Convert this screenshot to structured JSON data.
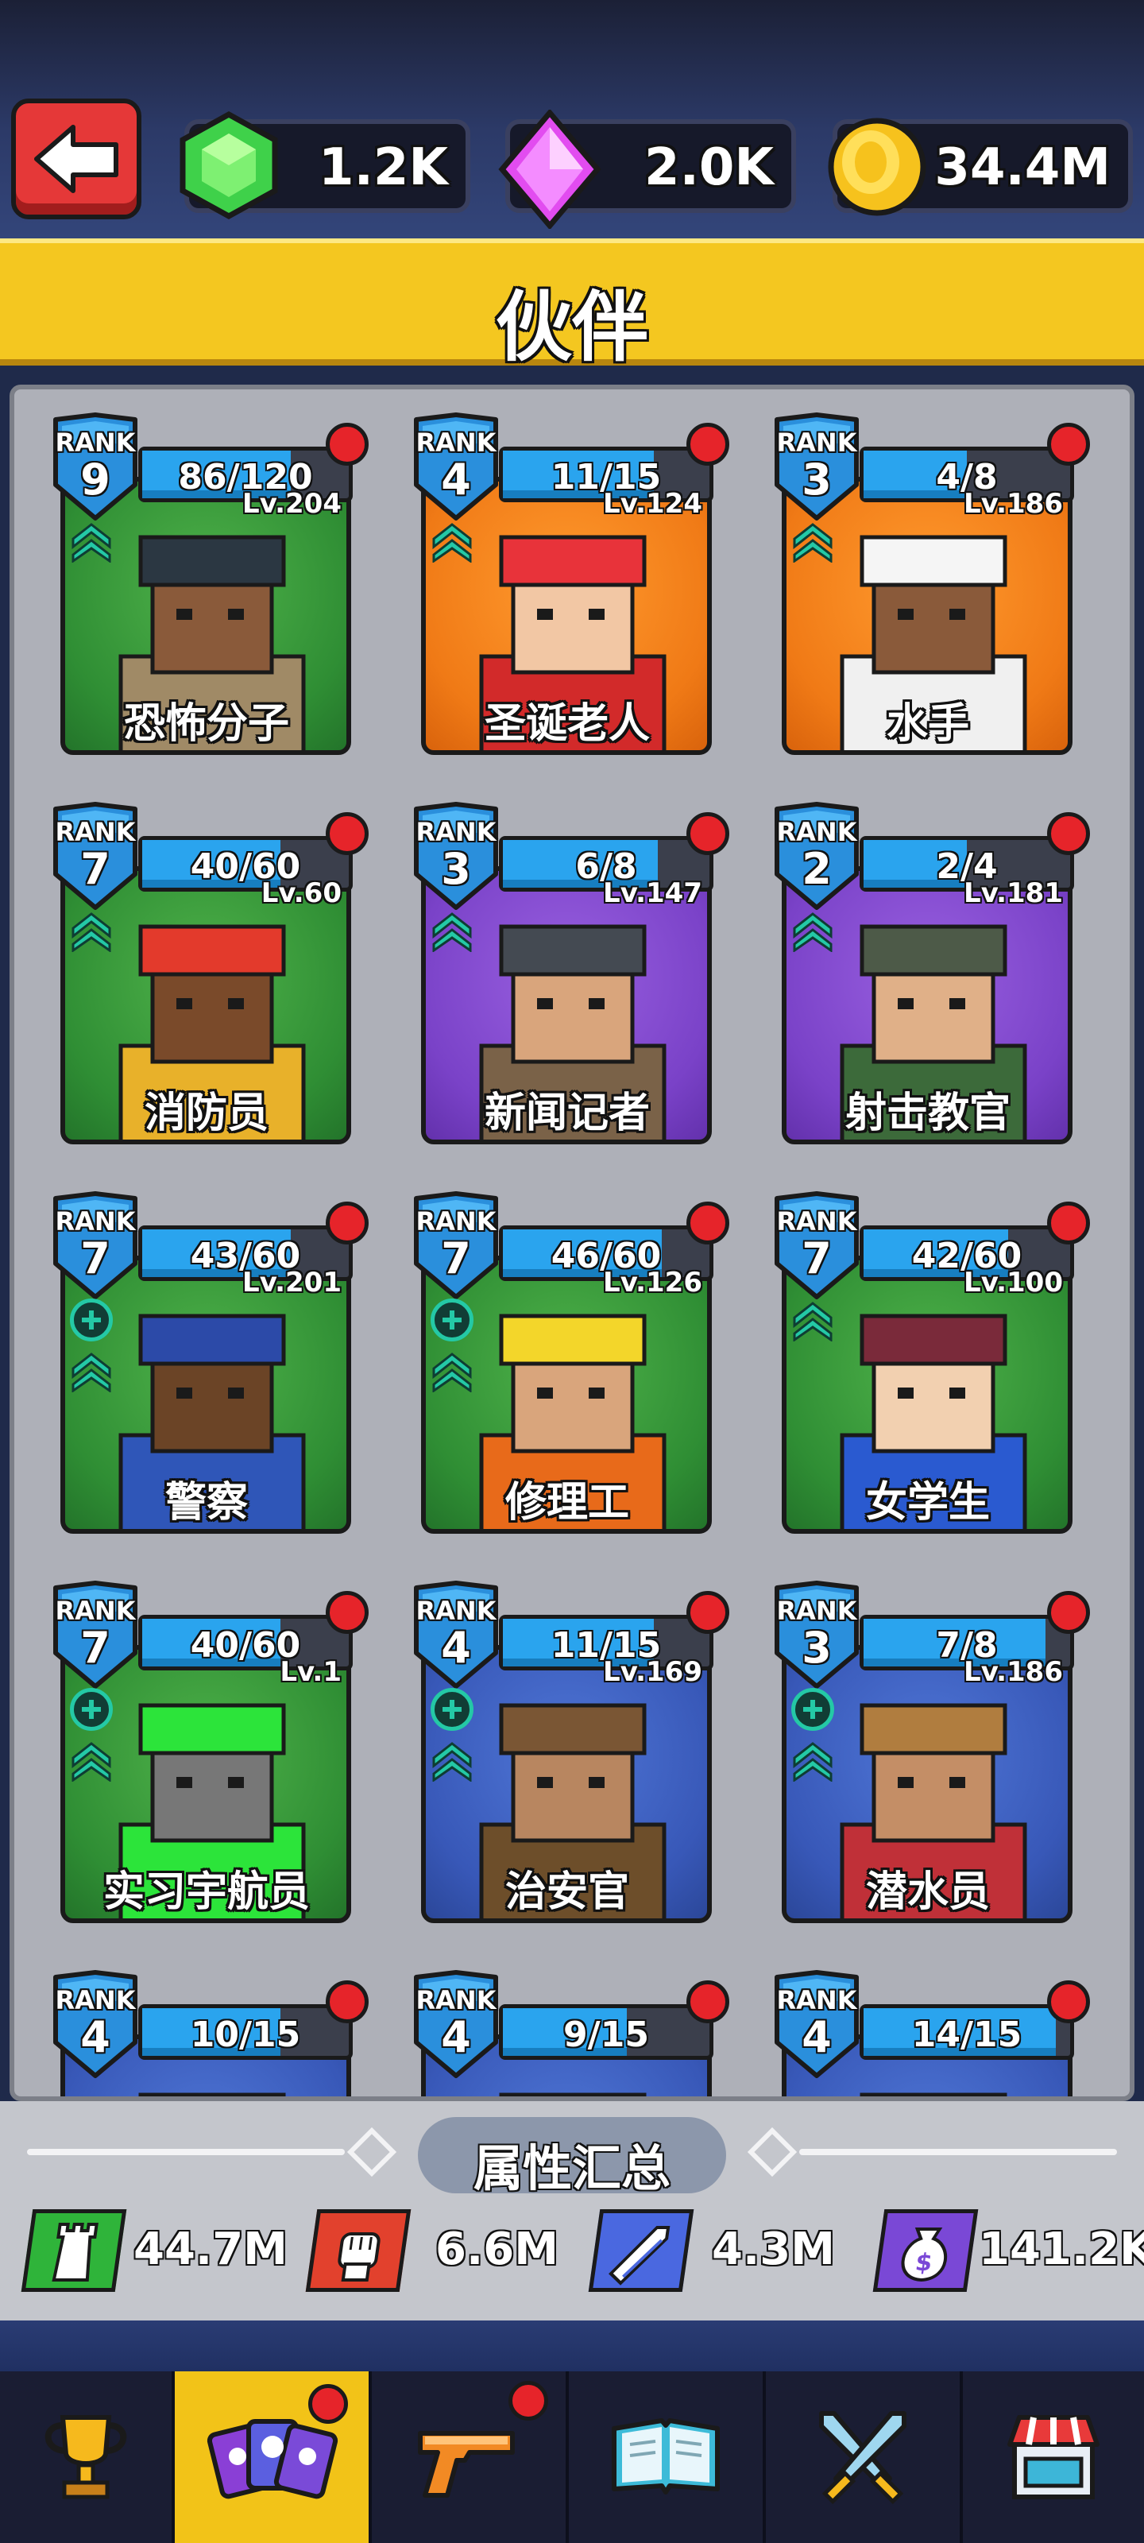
{
  "header": {
    "back_label": "back",
    "currencies": [
      {
        "name": "green-gem",
        "value": "1.2K",
        "color": "#3fd14a"
      },
      {
        "name": "pink-diamond",
        "value": "2.0K",
        "color": "#e24cf0"
      },
      {
        "name": "gold-coin",
        "value": "34.4M",
        "color": "#f6c21d"
      }
    ]
  },
  "title": "伙伴",
  "partners": [
    {
      "rank": "9",
      "progress": "86/120",
      "fill": 0.72,
      "level": "Lv.204",
      "name": "恐怖分子",
      "bg": "green",
      "plus": false
    },
    {
      "rank": "4",
      "progress": "11/15",
      "fill": 0.73,
      "level": "Lv.124",
      "name": "圣诞老人",
      "bg": "orange",
      "plus": false
    },
    {
      "rank": "3",
      "progress": "4/8",
      "fill": 0.5,
      "level": "Lv.186",
      "name": "水手",
      "bg": "orange",
      "plus": false
    },
    {
      "rank": "7",
      "progress": "40/60",
      "fill": 0.67,
      "level": "Lv.60",
      "name": "消防员",
      "bg": "green",
      "plus": false
    },
    {
      "rank": "3",
      "progress": "6/8",
      "fill": 0.75,
      "level": "Lv.147",
      "name": "新闻记者",
      "bg": "purple",
      "plus": false
    },
    {
      "rank": "2",
      "progress": "2/4",
      "fill": 0.5,
      "level": "Lv.181",
      "name": "射击教官",
      "bg": "purple",
      "plus": false
    },
    {
      "rank": "7",
      "progress": "43/60",
      "fill": 0.72,
      "level": "Lv.201",
      "name": "警察",
      "bg": "green",
      "plus": true
    },
    {
      "rank": "7",
      "progress": "46/60",
      "fill": 0.77,
      "level": "Lv.126",
      "name": "修理工",
      "bg": "green",
      "plus": true
    },
    {
      "rank": "7",
      "progress": "42/60",
      "fill": 0.7,
      "level": "Lv.100",
      "name": "女学生",
      "bg": "green",
      "plus": false
    },
    {
      "rank": "7",
      "progress": "40/60",
      "fill": 0.67,
      "level": "Lv.1",
      "name": "实习宇航员",
      "bg": "green",
      "plus": true
    },
    {
      "rank": "4",
      "progress": "11/15",
      "fill": 0.73,
      "level": "Lv.169",
      "name": "治安官",
      "bg": "blue",
      "plus": true
    },
    {
      "rank": "3",
      "progress": "7/8",
      "fill": 0.88,
      "level": "Lv.186",
      "name": "潜水员",
      "bg": "blue",
      "plus": true
    },
    {
      "rank": "4",
      "progress": "10/15",
      "fill": 0.67,
      "level": "",
      "name": "",
      "bg": "blue",
      "plus": false
    },
    {
      "rank": "4",
      "progress": "9/15",
      "fill": 0.6,
      "level": "",
      "name": "",
      "bg": "blue",
      "plus": false
    },
    {
      "rank": "4",
      "progress": "14/15",
      "fill": 0.93,
      "level": "",
      "name": "",
      "bg": "blue",
      "plus": false
    }
  ],
  "rank_label": "RANK",
  "summary": {
    "title": "属性汇总",
    "stats": [
      {
        "icon": "tower-icon",
        "value": "44.7M",
        "color": "#2fb43a"
      },
      {
        "icon": "fist-icon",
        "value": "6.6M",
        "color": "#e2412d"
      },
      {
        "icon": "auto-bullets-icon",
        "value": "4.3M",
        "color": "#4a68e0"
      },
      {
        "icon": "money-bag-icon",
        "value": "141.2K",
        "color": "#7a48d6"
      }
    ]
  },
  "nav": [
    {
      "icon": "trophy-icon",
      "active": false,
      "badge": false
    },
    {
      "icon": "partner-cards-icon",
      "active": true,
      "badge": true
    },
    {
      "icon": "pistol-icon",
      "active": false,
      "badge": true
    },
    {
      "icon": "book-icon",
      "active": false,
      "badge": false
    },
    {
      "icon": "crossed-swords-icon",
      "active": false,
      "badge": false
    },
    {
      "icon": "shop-icon",
      "active": false,
      "badge": false
    }
  ]
}
